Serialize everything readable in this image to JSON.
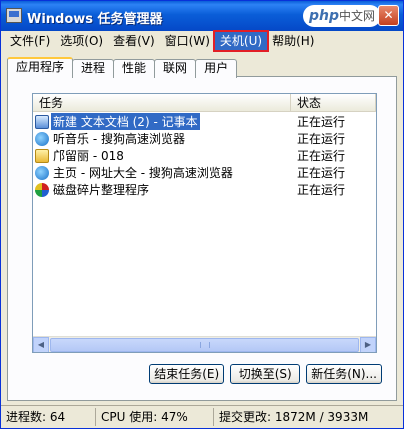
{
  "window": {
    "title": "Windows 任务管理器"
  },
  "logo": {
    "text": "php",
    "sub": "中文网"
  },
  "menu": [
    {
      "label": "文件(F)"
    },
    {
      "label": "选项(O)"
    },
    {
      "label": "查看(V)"
    },
    {
      "label": "窗口(W)"
    },
    {
      "label": "关机(U)"
    },
    {
      "label": "帮助(H)"
    }
  ],
  "tabs": [
    {
      "label": "应用程序"
    },
    {
      "label": "进程"
    },
    {
      "label": "性能"
    },
    {
      "label": "联网"
    },
    {
      "label": "用户"
    }
  ],
  "list": {
    "headers": {
      "task": "任务",
      "status": "状态"
    },
    "rows": [
      {
        "task": "新建 文本文档 (2) - 记事本",
        "status": "正在运行",
        "icon": "notepad-icon"
      },
      {
        "task": "听音乐 - 搜狗高速浏览器",
        "status": "正在运行",
        "icon": "browser-icon"
      },
      {
        "task": "邝留丽 - 018",
        "status": "正在运行",
        "icon": "folder-icon"
      },
      {
        "task": "主页 - 网址大全 - 搜狗高速浏览器",
        "status": "正在运行",
        "icon": "browser-icon"
      },
      {
        "task": "磁盘碎片整理程序",
        "status": "正在运行",
        "icon": "defrag-icon"
      }
    ]
  },
  "buttons": {
    "end_task": "结束任务(E)",
    "switch_to": "切换至(S)",
    "new_task": "新任务(N)..."
  },
  "status": {
    "processes": "进程数: 64",
    "cpu": "CPU 使用: 47%",
    "commit": "提交更改: 1872M / 3933M"
  },
  "colors": {
    "highlight_border": "#e21e26",
    "selection": "#316ac5",
    "titlebar": "#0a5ed8"
  }
}
